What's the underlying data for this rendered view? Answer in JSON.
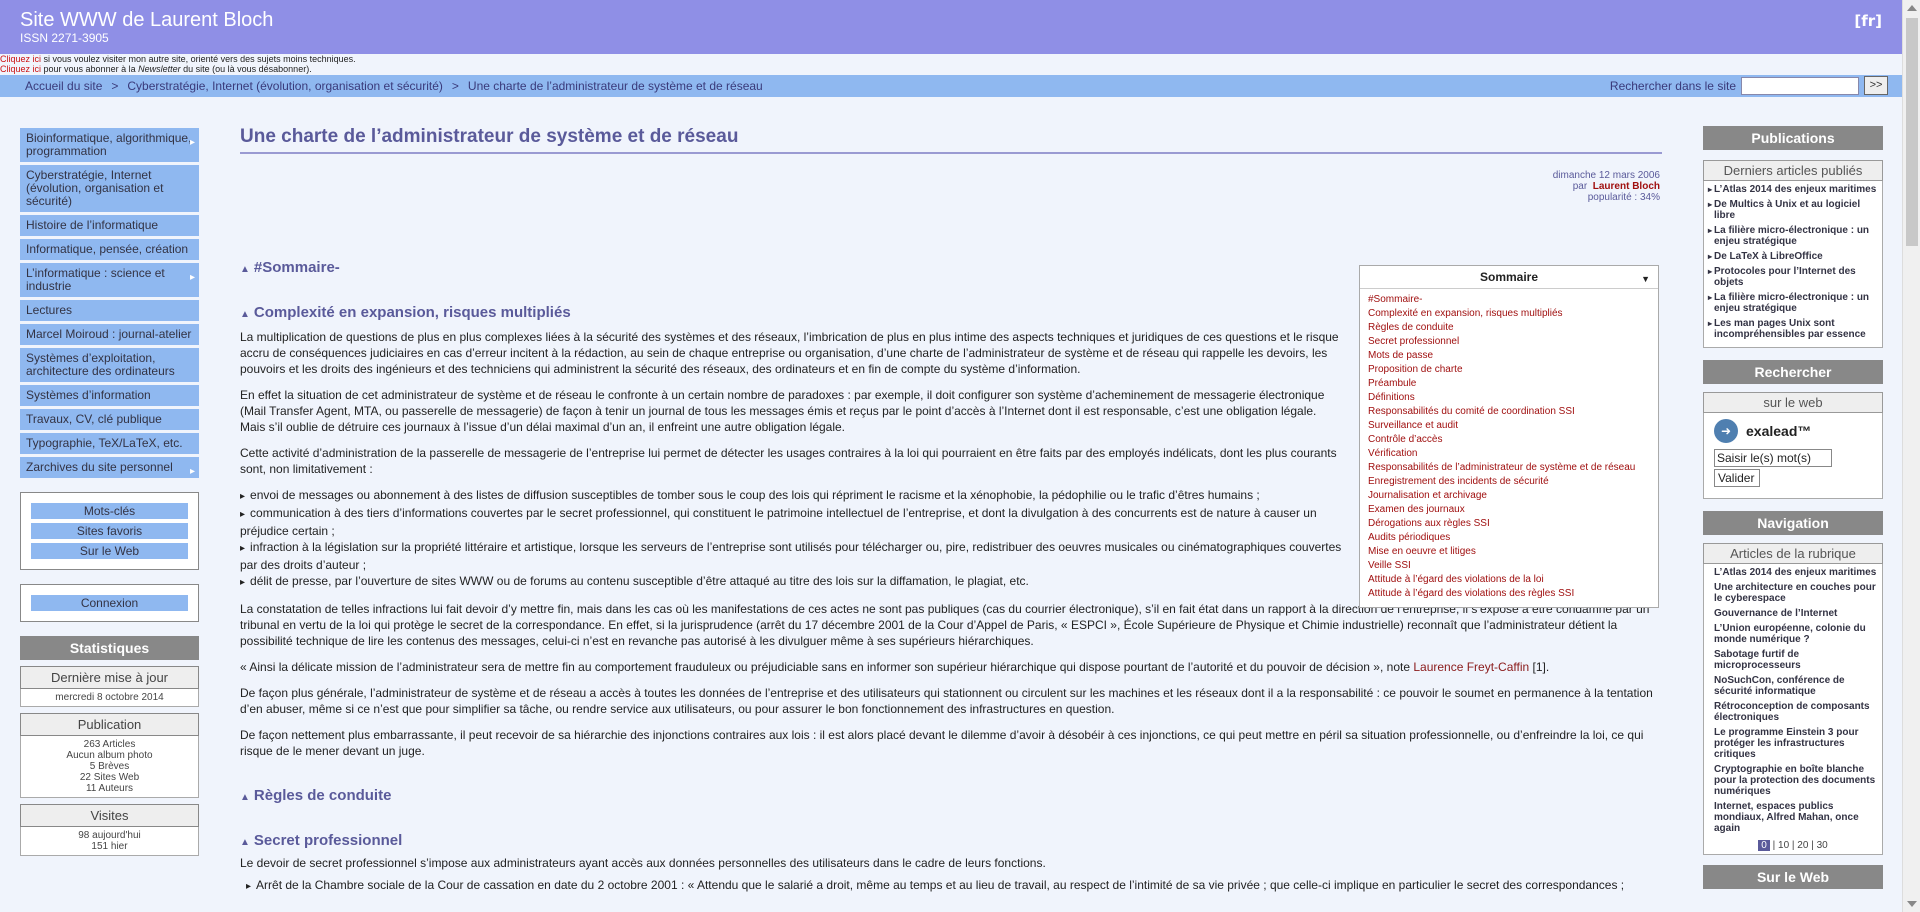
{
  "banner": {
    "title": "Site WWW de Laurent Bloch",
    "issn": "ISSN 2271-3905",
    "lang": "[fr]"
  },
  "notes": {
    "line1_link": "Cliquez ici",
    "line1_text": " si vous voulez visiter mon autre site, ",
    "line1_link2": "orienté vers des sujets moins techniques.",
    "line2_link": "Cliquez ici",
    "line2_text": " pour vous abonner à la ",
    "line2_em": "Newsletter",
    "line2_text2": " du site (ou là vous désabonner)."
  },
  "breadcrumbs": [
    "Accueil du site",
    "Cyberstratégie, Internet (évolution, organisation et sécurité)",
    "Une charte de l’administrateur de système et de réseau"
  ],
  "search": {
    "label": "Rechercher dans le site",
    "button": ">>"
  },
  "left_nav": [
    {
      "label": "Bioinformatique, algorithmique, programmation"
    },
    {
      "label": "Cyberstratégie, Internet (évolution, organisation et sécurité)"
    },
    {
      "label": "Histoire de l’informatique"
    },
    {
      "label": "Informatique, pensée, création"
    },
    {
      "label": "L’informatique : science et industrie"
    },
    {
      "label": "Lectures"
    },
    {
      "label": "Marcel Moiroud : journal-atelier"
    },
    {
      "label": "Systèmes d’exploitation, architecture des ordinateurs"
    },
    {
      "label": "Systèmes d’information"
    },
    {
      "label": "Travaux, CV, clé publique"
    },
    {
      "label": "Typographie, TeX/LaTeX, etc."
    },
    {
      "label": "Zarchives du site personnel"
    }
  ],
  "quick_links": [
    "Mots-clés",
    "Sites favoris",
    "Sur le Web"
  ],
  "login": "Connexion",
  "stats": {
    "title": "Statistiques",
    "last_update_title": "Dernière mise à jour",
    "last_update": "mercredi 8 octobre 2014",
    "pub_title": "Publication",
    "pub_lines": [
      "263 Articles",
      "Aucun album photo",
      "5 Brèves",
      "22 Sites Web",
      "11 Auteurs"
    ],
    "visits_title": "Visites",
    "visits_lines": [
      "98 aujourd'hui",
      "151 hier"
    ]
  },
  "article": {
    "title": "Une charte de l’administrateur de système et de réseau",
    "date": "dimanche 12 mars 2006",
    "by": "par",
    "author": "Laurent Bloch",
    "popularity": "popularité : 34%",
    "h_sommaire": "#Sommaire-",
    "h_complexite": "Complexité en expansion, risques multipliés",
    "p1": "La multiplication de questions de plus en plus complexes liées à la sécurité des systèmes et des réseaux, l’imbrication de plus en plus intime des aspects techniques et juridiques de ces questions et le risque accru de conséquences judiciaires en cas d’erreur incitent à la rédaction, au sein de chaque entreprise ou organisation, d’une charte de l’administrateur de système et de réseau qui rappelle les devoirs, les pouvoirs et les droits des ingénieurs et des techniciens qui administrent la sécurité des réseaux, des ordinateurs et en fin de compte du système d’information.",
    "p2": "En effet la situation de cet administrateur de système et de réseau le confronte à un certain nombre de paradoxes : par exemple, il doit configurer son système d’acheminement de messagerie électronique (Mail Transfer Agent, MTA, ou passerelle de messagerie) de façon à tenir un journal de tous les messages émis et reçus par le point d’accès à l’Internet dont il est responsable, c’est une obligation légale. Mais s’il oublie de détruire ces journaux à l’issue d’un délai maximal d’un an, il enfreint une autre obligation légale.",
    "p3": "Cette activité d’administration de la passerelle de messagerie de l’entreprise lui permet de détecter les usages contraires à la loi qui pourraient en être faits par des employés indélicats, dont les plus courants sont, non limitativement :",
    "bullets": [
      "envoi de messages ou abonnement à des listes de diffusion susceptibles de tomber sous le coup des lois qui répriment le racisme et la xénophobie, la pédophilie ou le trafic d’êtres humains ;",
      "communication à des tiers d’informations couvertes par le secret professionnel, qui constituent le patrimoine intellectuel de l’entreprise, et dont la divulgation à des concurrents est de nature à causer un préjudice certain ;",
      "infraction à la législation sur la propriété littéraire et artistique, lorsque les serveurs de l’entreprise sont utilisés pour télécharger ou, pire, redistribuer des oeuvres musicales ou cinématographiques couvertes par des droits d’auteur ;",
      "délit de presse, par l’ouverture de sites WWW ou de forums au contenu susceptible d’être attaqué au titre des lois sur la diffamation, le plagiat, etc."
    ],
    "p4": "La constatation de telles infractions lui fait devoir d’y mettre fin, mais dans les cas où les manifestations de ces actes ne sont pas publiques (cas du courrier électronique), s’il en fait état dans un rapport à la direction de l’entreprise, il s’expose à être condamné par un tribunal en vertu de la loi qui protège le secret de la correspondance. En effet, si la jurisprudence (arrêt du 17 décembre 2001 de la Cour d’Appel de Paris, « ESPCI », École Supérieure de Physique et Chimie industrielle) reconnaît que l’administrateur détient la possibilité technique de lire les contenus des messages, celui-ci n’est en revanche pas autorisé à les divulguer même à ses supérieurs hiérarchiques.",
    "p5a": "« Ainsi la délicate mission de l’administrateur sera de mettre fin au comportement frauduleux ou préjudiciable sans en informer son supérieur hiérarchique qui dispose pourtant de l’autorité et du pouvoir de décision », note ",
    "p5_link": "Laurence Freyt-Caffin",
    "p5_ref": " [1].",
    "p6": "De façon plus générale, l’administrateur de système et de réseau a accès à toutes les données de l’entreprise et des utilisateurs qui stationnent ou circulent sur les machines et les réseaux dont il a la responsabilité : ce pouvoir le soumet en permanence à la tentation d’en abuser, même si ce n’est que pour simplifier sa tâche, ou rendre service aux utilisateurs, ou pour assurer le bon fonctionnement des infrastructures en question.",
    "p7": "De façon nettement plus embarrassante, il peut recevoir de sa hiérarchie des injonctions contraires aux lois : il est alors placé devant le dilemme d’avoir à désobéir à ces injonctions, ce qui peut mettre en péril sa situation professionnelle, ou d’enfreindre la loi, ce qui risque de le mener devant un juge.",
    "h_regles": "Règles de conduite",
    "h_secret": "Secret professionnel",
    "p8": "Le devoir de secret professionnel s’impose aux administrateurs ayant accès aux données personnelles des utilisateurs dans le cadre de leurs fonctions.",
    "bullet2": "Arrêt de la Chambre sociale de la Cour de cassation en date du 2 octobre 2001 : « Attendu que le salarié a droit, même au temps et au lieu de travail, au respect de l’intimité de sa vie privée ; que celle-ci implique en particulier le secret des correspondances ;"
  },
  "toc": {
    "title": "Sommaire",
    "items": [
      "#Sommaire-",
      "Complexité en expansion, risques multipliés",
      "Règles de conduite",
      "Secret professionnel",
      "Mots de passe",
      "Proposition de charte",
      "Préambule",
      "Définitions",
      "Responsabilités du comité de coordination SSI",
      "Surveillance et audit",
      "Contrôle d’accès",
      "Vérification",
      "Responsabilités de l’administrateur de système et de réseau",
      "Enregistrement des incidents de sécurité",
      "Journalisation et archivage",
      "Examen des journaux",
      "Dérogations aux règles SSI",
      "Audits périodiques",
      "Mise en oeuvre et litiges",
      "Veille SSI",
      "Attitude à l’égard des violations de la loi",
      "Attitude à l’égard des violations des règles SSI"
    ]
  },
  "right": {
    "publications": "Publications",
    "latest_title": "Derniers articles publiés",
    "latest": [
      "L’Atlas 2014 des enjeux maritimes",
      "De Multics à Unix et au logiciel libre",
      "La filière micro-électronique : un enjeu stratégique",
      "De LaTeX à LibreOffice",
      "Protocoles pour l’Internet des objets",
      "La filière micro-électronique : un enjeu stratégique",
      "Les man pages Unix sont incompréhensibles par essence"
    ],
    "search_title": "Rechercher",
    "web_title": "sur le web",
    "exalead": "exalead™",
    "ex_placeholder": "Saisir le(s) mot(s)",
    "ex_btn": "Valider",
    "nav_title": "Navigation",
    "rub_title": "Articles de la rubrique",
    "rub": [
      "L’Atlas 2014 des enjeux maritimes",
      "Une architecture en couches pour le cyberespace",
      "Gouvernance de l’Internet",
      "L’Union européenne, colonie du monde numérique ?",
      "Sabotage furtif de microprocesseurs",
      "NoSuchCon, conférence de sécurité informatique",
      "Rétroconception de composants électroniques",
      "Le programme Einstein 3 pour protéger les infrastructures critiques",
      "Cryptographie en boîte blanche pour la protection des documents numériques",
      "Internet, espaces publics mondiaux, Alfred Mahan, once again"
    ],
    "pager": [
      "0",
      "10",
      "20",
      "30"
    ],
    "surweb": "Sur le Web"
  }
}
